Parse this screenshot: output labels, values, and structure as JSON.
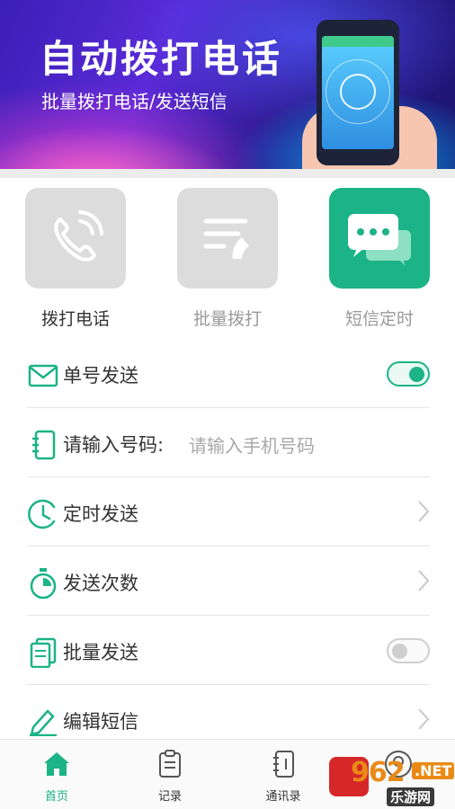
{
  "banner": {
    "title": "自动拨打电话",
    "subtitle": "批量拨打电话/发送短信"
  },
  "actions": [
    {
      "label": "拨打电话",
      "icon": "phone-call-icon",
      "state": "inactive"
    },
    {
      "label": "批量拨打",
      "icon": "batch-dial-icon",
      "state": "inactive"
    },
    {
      "label": "短信定时",
      "icon": "sms-bubble-icon",
      "state": "active"
    }
  ],
  "rows": {
    "single": {
      "label": "单号发送",
      "icon": "envelope-icon",
      "toggle_on": true
    },
    "number": {
      "label": "请输入号码:",
      "placeholder": "请输入手机号码",
      "icon": "address-book-icon"
    },
    "timer": {
      "label": "定时发送",
      "icon": "clock-icon"
    },
    "count": {
      "label": "发送次数",
      "icon": "stopwatch-icon"
    },
    "batch": {
      "label": "批量发送",
      "icon": "documents-icon",
      "toggle_on": false
    },
    "edit": {
      "label": "编辑短信",
      "icon": "pencil-icon"
    }
  },
  "nav": [
    {
      "label": "首页",
      "icon": "home-icon",
      "active": true
    },
    {
      "label": "记录",
      "icon": "clipboard-icon",
      "active": false
    },
    {
      "label": "通讯录",
      "icon": "contacts-icon",
      "active": false
    },
    {
      "label": "",
      "icon": "profile-icon",
      "active": false
    }
  ],
  "watermark": {
    "number": "962",
    "net": ".NET",
    "cn": "乐游网"
  },
  "colors": {
    "accent": "#1cb386",
    "banner": "#3a1fb5",
    "inactive_tile": "#dcdcdc"
  }
}
